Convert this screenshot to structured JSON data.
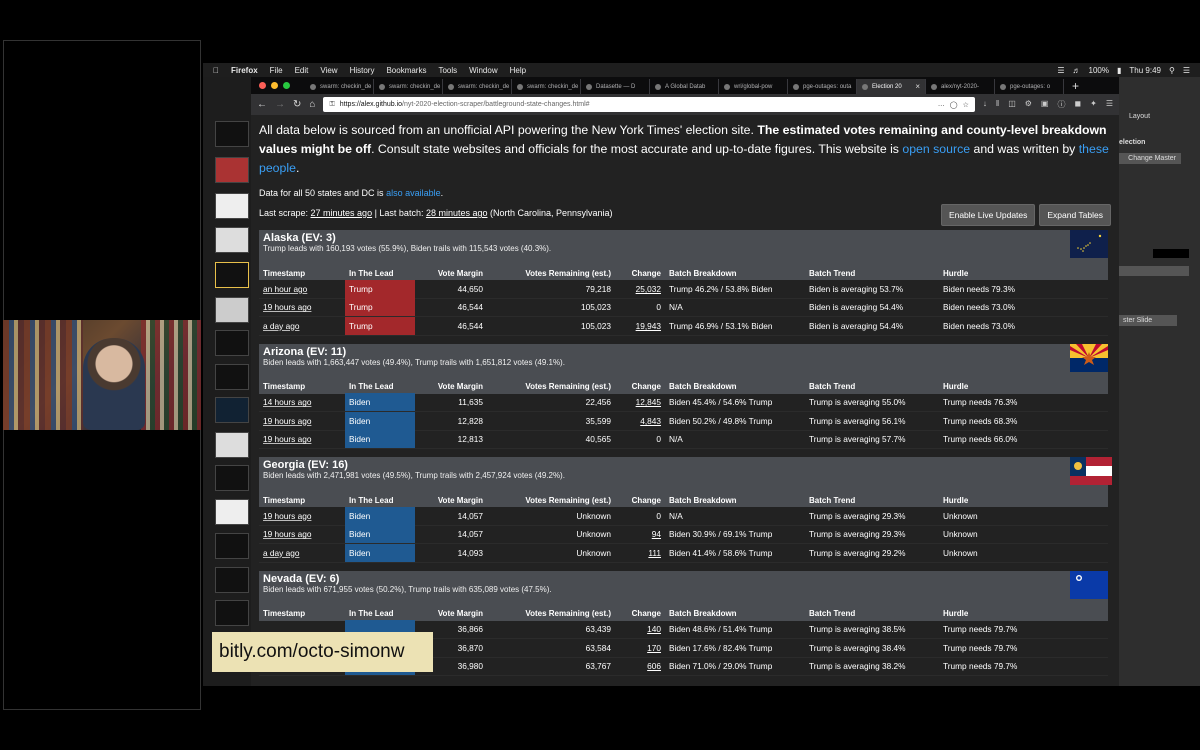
{
  "menubar": {
    "app": "Firefox",
    "items": [
      "File",
      "Edit",
      "View",
      "History",
      "Bookmarks",
      "Tools",
      "Window",
      "Help"
    ],
    "battery": "100%",
    "clock": "Thu 9:49"
  },
  "tabs": [
    {
      "label": "swarm: checkin_de"
    },
    {
      "label": "swarm: checkin_de"
    },
    {
      "label": "swarm: checkin_de"
    },
    {
      "label": "swarm: checkin_de"
    },
    {
      "label": "Datasette — D"
    },
    {
      "label": "A Global Datab"
    },
    {
      "label": "wri/global-pow"
    },
    {
      "label": "pge-outages: outa"
    },
    {
      "label": "Election 20",
      "active": true
    },
    {
      "label": "alex/nyt-2020-"
    },
    {
      "label": "pge-outages: o"
    }
  ],
  "url": {
    "host": "https://alex.github.io",
    "path": "/nyt-2020-election-scraper/battleground-state-changes.html#"
  },
  "intro": {
    "t1": "All data below is sourced from an unofficial API powering the New York Times' election site. ",
    "bold": "The estimated votes remaining and county-level breakdown values might be off",
    "t2": ". Consult state websites and officials for the most accurate and up-to-date figures. This website is ",
    "link1": "open source",
    "t3": " and was written by ",
    "link2": "these people",
    "t4": "."
  },
  "all_states": {
    "prefix": "Data for all 50 states and DC is ",
    "link": "also available",
    "suffix": "."
  },
  "scrape": {
    "prefix": "Last scrape: ",
    "scrape_time": "27 minutes ago",
    "mid": " | Last batch: ",
    "batch_time": "28 minutes ago",
    "suffix": " (North Carolina, Pennsylvania)"
  },
  "buttons": {
    "live": "Enable Live Updates",
    "expand": "Expand Tables"
  },
  "headers": [
    "Timestamp",
    "In The Lead",
    "Vote Margin",
    "Votes Remaining (est.)",
    "Change",
    "Batch Breakdown",
    "Batch Trend",
    "Hurdle"
  ],
  "states": [
    {
      "name": "Alaska (EV: 3)",
      "summary": "Trump leads with 160,193 votes (55.9%), Biden trails with 115,543 votes (40.3%).",
      "flag": "alaska-flag",
      "rows": [
        [
          "an hour ago",
          "Trump",
          "44,650",
          "79,218",
          "25,032",
          "Trump 46.2% / 53.8% Biden",
          "Biden is averaging 53.7%",
          "Biden needs 79.3%"
        ],
        [
          "19 hours ago",
          "Trump",
          "46,544",
          "105,023",
          "0",
          "N/A",
          "Biden is averaging 54.4%",
          "Biden needs 73.0%"
        ],
        [
          "a day ago",
          "Trump",
          "46,544",
          "105,023",
          "19,943",
          "Trump 46.9% / 53.1% Biden",
          "Biden is averaging 54.4%",
          "Biden needs 73.0%"
        ]
      ]
    },
    {
      "name": "Arizona (EV: 11)",
      "summary": "Biden leads with 1,663,447 votes (49.4%), Trump trails with 1,651,812 votes (49.1%).",
      "flag": "arizona-flag",
      "rows": [
        [
          "14 hours ago",
          "Biden",
          "11,635",
          "22,456",
          "12,845",
          "Biden 45.4% / 54.6% Trump",
          "Trump is averaging 55.0%",
          "Trump needs 76.3%"
        ],
        [
          "19 hours ago",
          "Biden",
          "12,828",
          "35,599",
          "4,843",
          "Biden 50.2% / 49.8% Trump",
          "Trump is averaging 56.1%",
          "Trump needs 68.3%"
        ],
        [
          "19 hours ago",
          "Biden",
          "12,813",
          "40,565",
          "0",
          "N/A",
          "Trump is averaging 57.7%",
          "Trump needs 66.0%"
        ]
      ]
    },
    {
      "name": "Georgia (EV: 16)",
      "summary": "Biden leads with 2,471,981 votes (49.5%), Trump trails with 2,457,924 votes (49.2%).",
      "flag": "georgia-flag",
      "rows": [
        [
          "19 hours ago",
          "Biden",
          "14,057",
          "Unknown",
          "0",
          "N/A",
          "Trump is averaging 29.3%",
          "Unknown"
        ],
        [
          "19 hours ago",
          "Biden",
          "14,057",
          "Unknown",
          "94",
          "Biden 30.9% / 69.1% Trump",
          "Trump is averaging 29.3%",
          "Unknown"
        ],
        [
          "a day ago",
          "Biden",
          "14,093",
          "Unknown",
          "111",
          "Biden 41.4% / 58.6% Trump",
          "Trump is averaging 29.2%",
          "Unknown"
        ]
      ]
    },
    {
      "name": "Nevada (EV: 6)",
      "summary": "Biden leads with 671,955 votes (50.2%), Trump trails with 635,089 votes (47.5%).",
      "flag": "nevada-flag",
      "rows": [
        [
          "",
          "",
          "36,866",
          "63,439",
          "140",
          "Biden 48.6% / 51.4% Trump",
          "Trump is averaging 38.5%",
          "Trump needs 79.7%"
        ],
        [
          "a day ago",
          "",
          "36,870",
          "63,584",
          "170",
          "Biden 17.6% / 82.4% Trump",
          "Trump is averaging 38.4%",
          "Trump needs 79.7%"
        ],
        [
          "a day ago",
          "Biden",
          "36,980",
          "63,767",
          "606",
          "Biden 71.0% / 29.0% Trump",
          "Trump is averaging 38.2%",
          "Trump needs 79.7%"
        ]
      ]
    }
  ],
  "overlay": "bitly.com/octo-simonw",
  "app_right": {
    "layout": "Layout",
    "selection": "election",
    "change_master": "Change Master",
    "master_slide": "ster Slide"
  }
}
